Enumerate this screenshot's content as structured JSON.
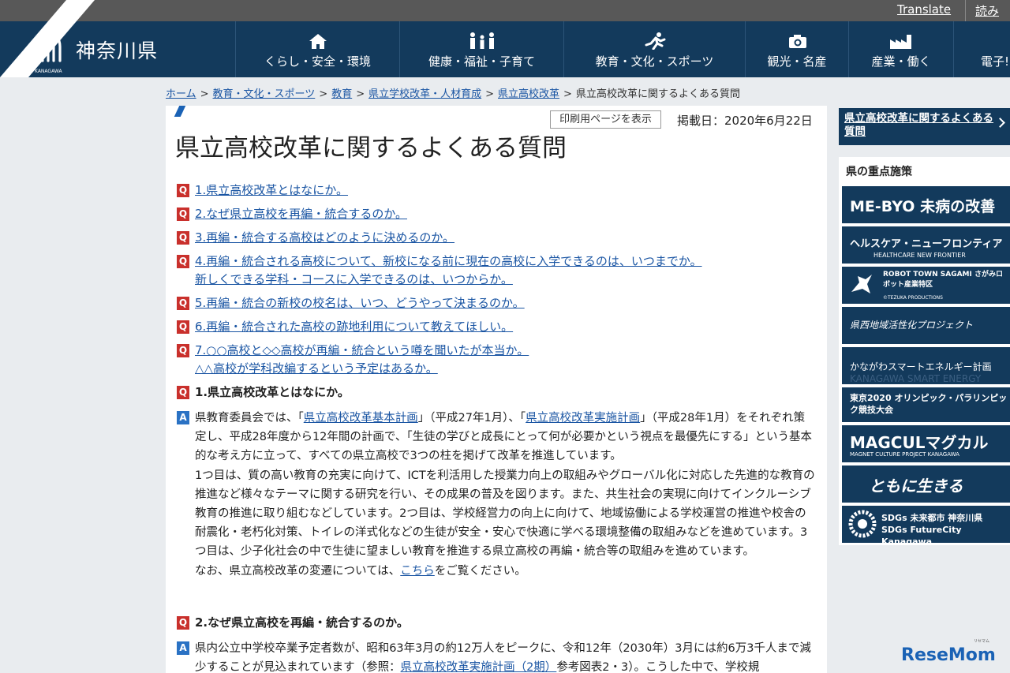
{
  "utility": {
    "translate": "Translate",
    "read_aloud": "読み上"
  },
  "header": {
    "site_name": "神奈川県",
    "site_sub": "KANAGAWA",
    "nav": [
      {
        "label": "くらし・安全・環境",
        "icon": "house-icon"
      },
      {
        "label": "健康・福祉・子育て",
        "icon": "family-icon"
      },
      {
        "label": "教育・文化・スポーツ",
        "icon": "runner-icon"
      },
      {
        "label": "観光・名産",
        "icon": "camera-icon"
      },
      {
        "label": "産業・働く",
        "icon": "factory-icon"
      },
      {
        "label": "電子!",
        "icon": ""
      }
    ]
  },
  "breadcrumb": [
    "ホーム",
    "教育・文化・スポーツ",
    "教育",
    "県立学校改革・人材育成",
    "県立高校改革",
    "県立高校改革に関するよくある質問"
  ],
  "page": {
    "print_label": "印刷用ページを表示",
    "published": "掲載日：2020年6月22日",
    "title": "県立高校改革に関するよくある質問",
    "badge_q": "Q",
    "badge_a": "A",
    "questions": [
      {
        "line1": "1.県立高校改革とはなにか。",
        "line2": ""
      },
      {
        "line1": "2.なぜ県立高校を再編・統合するのか。",
        "line2": ""
      },
      {
        "line1": "3.再編・統合する高校はどのように決めるのか。",
        "line2": ""
      },
      {
        "line1": "4.再編・統合される高校について、新校になる前に現在の高校に入学できるのは、いつまでか。",
        "line2": "新しくできる学科・コースに入学できるのは、いつからか。"
      },
      {
        "line1": "5.再編・統合の新校の校名は、いつ、どうやって決まるのか。",
        "line2": ""
      },
      {
        "line1": "6.再編・統合された高校の跡地利用について教えてほしい。",
        "line2": ""
      },
      {
        "line1": "7.○○高校と◇◇高校が再編・統合という噂を聞いたが本当か。",
        "line2": "△△高校が学科改編するという予定はあるか。"
      }
    ],
    "section1": {
      "heading": "1.県立高校改革とはなにか。",
      "a_lead1": "県教育委員会では、「",
      "a_link1": "県立高校改革基本計画",
      "a_mid1": "」（平成27年1月）、「",
      "a_link2": "県立高校改革実施計画",
      "a_rest1": "」（平成28年1月）をそれぞれ策定し、平成28年度から12年間の計画で、「生徒の学びと成長にとって何が必要かという視点を最優先にする」という基本的な考え方に立って、すべての県立高校で3つの柱を掲げて改革を推進しています。",
      "para2": "1つ目は、質の高い教育の充実に向けて、ICTを利活用した授業力向上の取組みやグローバル化に対応した先進的な教育の推進など様々なテーマに関する研究を行い、その成果の普及を図ります。また、共生社会の実現に向けてインクルーシブ教育の推進に取り組むなどしています。2つ目は、学校経営力の向上に向けて、地域協働による学校運営の推進や校舎の耐震化・老朽化対策、トイレの洋式化などの生徒が安全・安心で快適に学べる環境整備の取組みなどを進めています。3つ目は、少子化社会の中で生徒に望ましい教育を推進する県立高校の再編・統合等の取組みを進めています。",
      "para3_lead": "なお、県立高校改革の変遷については、",
      "para3_link": "こちら",
      "para3_tail": "をご覧ください。"
    },
    "section2": {
      "heading": "2.なぜ県立高校を再編・統合するのか。",
      "a_text1": "県内公立中学校卒業予定者数が、昭和63年3月の約12万人をピークに、令和12年（2030年）3月には約6万3千人まで減少することが見込まれています（参照：",
      "a_link": "県立高校改革実施計画（2期）",
      "a_text2": "参考図表2・3）。こうした中で、学校規"
    }
  },
  "sidebar": {
    "current_link": "県立高校改革に関するよくある質問",
    "section_title": "県の重点施策",
    "banners": [
      {
        "main": "ME-BYO 未病の改善",
        "sub": ""
      },
      {
        "main": "ヘルスケア・ニューフロンティア",
        "sub": "HEALTHCARE NEW FRONTIER"
      },
      {
        "main": "ROBOT TOWN SAGAMI さがみロボット産業特区",
        "sub": "©TEZUKA PRODUCTIONS"
      },
      {
        "main": "県西地域活性化プロジェクト",
        "sub": ""
      },
      {
        "main": "かながわスマートエネルギー計画",
        "sub": "KANAGAWA SMART ENERGY"
      },
      {
        "main": "東京2020 オリンピック・パラリンピック競技大会",
        "sub": ""
      },
      {
        "main": "MAGCULマグカル",
        "sub": "MAGNET CULTURE PROJECT KANAGAWA"
      },
      {
        "main": "ともに生きる",
        "sub": ""
      },
      {
        "main": "SDGs 未来都市 神奈川県 SDGs FutureCity Kanagawa",
        "sub": ""
      }
    ]
  },
  "watermark": {
    "text": "ReseMom",
    "sub": "リセマム"
  }
}
